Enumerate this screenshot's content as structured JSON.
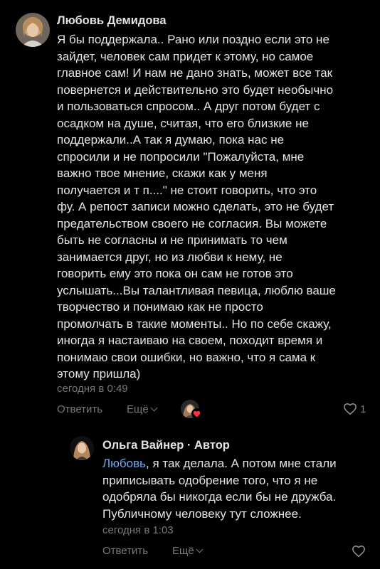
{
  "comment": {
    "author": "Любовь Демидова",
    "text_lines": [
      "Я бы поддержала.. Рано или поздно если это не",
      "зайдет, человек сам придет к этому, но самое",
      "главное сам! И нам не дано знать, может все так",
      "повернется и действительно это будет необычно",
      "и пользоваться спросом.. А друг потом будет с",
      "осадком на душе, считая, что его близкие не",
      "поддержали..А так я думаю, пока нас не",
      "спросили и не попросили \"Пожалуйста, мне",
      "важно твое мнение, скажи как у меня",
      "получается и т п....\" не стоит говорить, что это",
      "фу. А репост записи можно сделать, это не будет",
      "предательством своего не согласия. Вы можете",
      "быть не согласны и не принимать то чем",
      "занимается друг, но из любви к нему, не",
      "говорить ему это пока он сам не готов это",
      "услышать...Вы талантливая певица, люблю ваше",
      "творчество и понимаю как не просто",
      "промолчать в такие моменты.. Но по себе скажу,",
      "иногда я настаиваю на своем, походит время и",
      "понимаю свои ошибки, но важно, что я сама к",
      "этому пришла)"
    ],
    "timestamp": "сегодня в 0:49",
    "reply_label": "Ответить",
    "more_label": "Ещё",
    "like_count": "1"
  },
  "reply": {
    "author": "Ольга Вайнер · Автор",
    "mention": "Любовь",
    "first_line_rest": ", я так делала. А потом мне стали",
    "text_lines": [
      "приписывать одобрение того, что я не",
      "одобряла бы никогда если бы не дружба.",
      "Публичному человеку тут сложнее."
    ],
    "timestamp": "сегодня в 1:03",
    "reply_label": "Ответить",
    "more_label": "Ещё"
  },
  "colors": {
    "background": "#000000",
    "text": "#e1e3e6",
    "secondary": "#76787a",
    "link": "#71aaeb",
    "heart": "#ff3347"
  }
}
